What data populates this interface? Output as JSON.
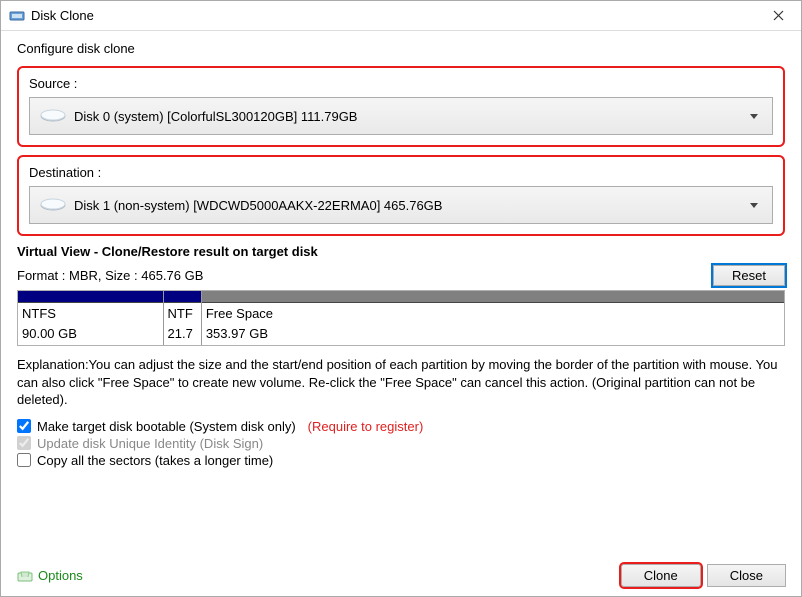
{
  "window": {
    "title": "Disk Clone"
  },
  "heading": "Configure disk clone",
  "source": {
    "label": "Source :",
    "text": "Disk 0 (system) [ColorfulSL300120GB]   111.79GB"
  },
  "destination": {
    "label": "Destination :",
    "text": "Disk 1 (non-system) [WDCWD5000AAKX-22ERMA0]   465.76GB"
  },
  "virtualView": {
    "title": "Virtual View - Clone/Restore result on target disk",
    "formatLine": "Format : MBR,  Size : 465.76 GB",
    "resetLabel": "Reset",
    "partitions": [
      {
        "name": "NTFS",
        "size": "90.00 GB",
        "widthPct": 19,
        "color": "blue"
      },
      {
        "name": "NTF",
        "size": "21.7",
        "widthPct": 5,
        "color": "blue"
      },
      {
        "name": "Free Space",
        "size": "353.97 GB",
        "widthPct": 76,
        "color": "gray"
      }
    ]
  },
  "explanation": "Explanation:You can adjust the size and the start/end position of each partition by moving the border of the partition with mouse. You can also click \"Free Space\" to create new volume. Re-click the \"Free Space\" can cancel this action. (Original partition can not be deleted).",
  "checks": {
    "bootable": {
      "label": "Make target disk bootable (System disk only)",
      "checked": true,
      "note": "(Require to register)"
    },
    "uniqueId": {
      "label": "Update disk Unique Identity (Disk Sign)",
      "checked": true,
      "disabled": true
    },
    "copyAll": {
      "label": "Copy all the sectors (takes a longer time)",
      "checked": false
    }
  },
  "footer": {
    "options": "Options",
    "clone": "Clone",
    "close": "Close"
  }
}
